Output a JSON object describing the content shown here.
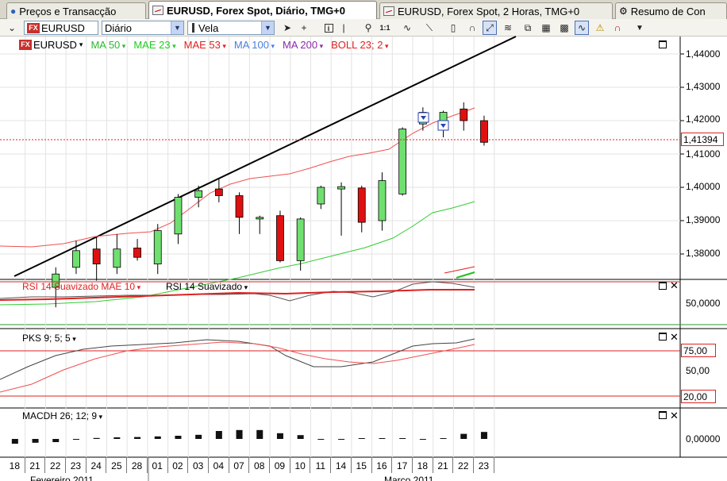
{
  "tabs": [
    {
      "label": "Preços e Transacção",
      "active": false
    },
    {
      "label": "EURUSD, Forex Spot, Diário, TMG+0",
      "active": true
    },
    {
      "label": "EURUSD, Forex Spot, 2 Horas, TMG+0",
      "active": false
    },
    {
      "label": "Resumo de Con",
      "active": false
    }
  ],
  "toolbar": {
    "symbol": "EURUSD",
    "period": "Diário",
    "chart_type": "Vela",
    "buttons": [
      "pointer-icon",
      "crosshair-icon",
      "info-icon",
      "vertical-line-icon",
      "zoom-icon",
      "one-to-one-icon",
      "wave-icon",
      "trend-line-icon",
      "eraser-icon",
      "magnet-icon",
      "trend-tool-icon",
      "indicators-icon",
      "duplicate-icon",
      "layout-icon",
      "overlay-icon",
      "wave-tool-icon",
      "alert-icon",
      "magnet2-icon"
    ]
  },
  "legend": {
    "symbol": "EURUSD",
    "items": [
      {
        "label": "MA 50",
        "color": "#2db82d"
      },
      {
        "label": "MAE 23",
        "color": "#1fcc1f"
      },
      {
        "label": "MAE 53",
        "color": "#e02020"
      },
      {
        "label": "MA 100",
        "color": "#4a7de0"
      },
      {
        "label": "MA 200",
        "color": "#8a2aa8"
      },
      {
        "label": "BOLL 23; 2",
        "color": "#e02020"
      }
    ]
  },
  "price_axis": {
    "labels": [
      "1,44000",
      "1,43000",
      "1,42000",
      "1,41000",
      "1,40000",
      "1,39000",
      "1,38000"
    ],
    "current": "1,41394"
  },
  "rsi_panel": {
    "title1": "RSI 14 Suavizado MAE 10",
    "title2": "RSI 14 Suavizado",
    "axis": "50,0000"
  },
  "pks_panel": {
    "title": "PKS 9; 5; 5",
    "upper": "75,00",
    "mid": "50,00",
    "lower": "20,00"
  },
  "macd_panel": {
    "title": "MACDH 26; 12; 9",
    "axis": "0,00000"
  },
  "dates": [
    "18",
    "21",
    "22",
    "23",
    "24",
    "25",
    "28",
    "01",
    "02",
    "03",
    "04",
    "07",
    "08",
    "09",
    "10",
    "11",
    "14",
    "15",
    "16",
    "17",
    "18",
    "21",
    "22",
    "23"
  ],
  "months": [
    "Fevereiro 2011",
    "Março 2011"
  ],
  "candles": [
    {
      "o": 1.37,
      "h": 1.376,
      "l": 1.364,
      "c": 1.374
    },
    {
      "o": 1.376,
      "h": 1.384,
      "l": 1.374,
      "c": 1.381
    },
    {
      "o": 1.3815,
      "h": 1.385,
      "l": 1.372,
      "c": 1.377
    },
    {
      "o": 1.376,
      "h": 1.386,
      "l": 1.374,
      "c": 1.3815
    },
    {
      "o": 1.3818,
      "h": 1.3845,
      "l": 1.378,
      "c": 1.379
    },
    {
      "o": 1.377,
      "h": 1.389,
      "l": 1.374,
      "c": 1.387
    },
    {
      "o": 1.386,
      "h": 1.398,
      "l": 1.383,
      "c": 1.397
    },
    {
      "o": 1.397,
      "h": 1.4005,
      "l": 1.394,
      "c": 1.399
    },
    {
      "o": 1.3995,
      "h": 1.4025,
      "l": 1.3955,
      "c": 1.3975
    },
    {
      "o": 1.3975,
      "h": 1.3985,
      "l": 1.386,
      "c": 1.391
    },
    {
      "o": 1.3905,
      "h": 1.3915,
      "l": 1.386,
      "c": 1.391
    },
    {
      "o": 1.3915,
      "h": 1.393,
      "l": 1.3775,
      "c": 1.378
    },
    {
      "o": 1.378,
      "h": 1.391,
      "l": 1.375,
      "c": 1.3905
    },
    {
      "o": 1.395,
      "h": 1.4005,
      "l": 1.3935,
      "c": 1.4
    },
    {
      "o": 1.3995,
      "h": 1.4015,
      "l": 1.3855,
      "c": 1.4002
    },
    {
      "o": 1.3998,
      "h": 1.4005,
      "l": 1.3865,
      "c": 1.3895
    },
    {
      "o": 1.39,
      "h": 1.4045,
      "l": 1.387,
      "c": 1.402
    },
    {
      "o": 1.398,
      "h": 1.418,
      "l": 1.3975,
      "c": 1.4175
    },
    {
      "o": 1.419,
      "h": 1.424,
      "l": 1.417,
      "c": 1.4225
    },
    {
      "o": 1.418,
      "h": 1.423,
      "l": 1.415,
      "c": 1.4225
    },
    {
      "o": 1.4235,
      "h": 1.4255,
      "l": 1.417,
      "c": 1.42
    },
    {
      "o": 1.42,
      "h": 1.4215,
      "l": 1.4125,
      "c": 1.4135
    }
  ],
  "macd_values": [
    -0.0015,
    -0.0012,
    -0.001,
    -0.0002,
    0.0003,
    0.0005,
    0.0006,
    0.0008,
    0.001,
    0.0013,
    0.0025,
    0.0028,
    0.0028,
    0.0018,
    0.0012,
    -0.0002,
    -0.0002,
    0.0002,
    0.0002,
    0.0,
    -0.0001,
    0.0,
    0.0016,
    0.0022,
    0.0026,
    0.0018
  ]
}
